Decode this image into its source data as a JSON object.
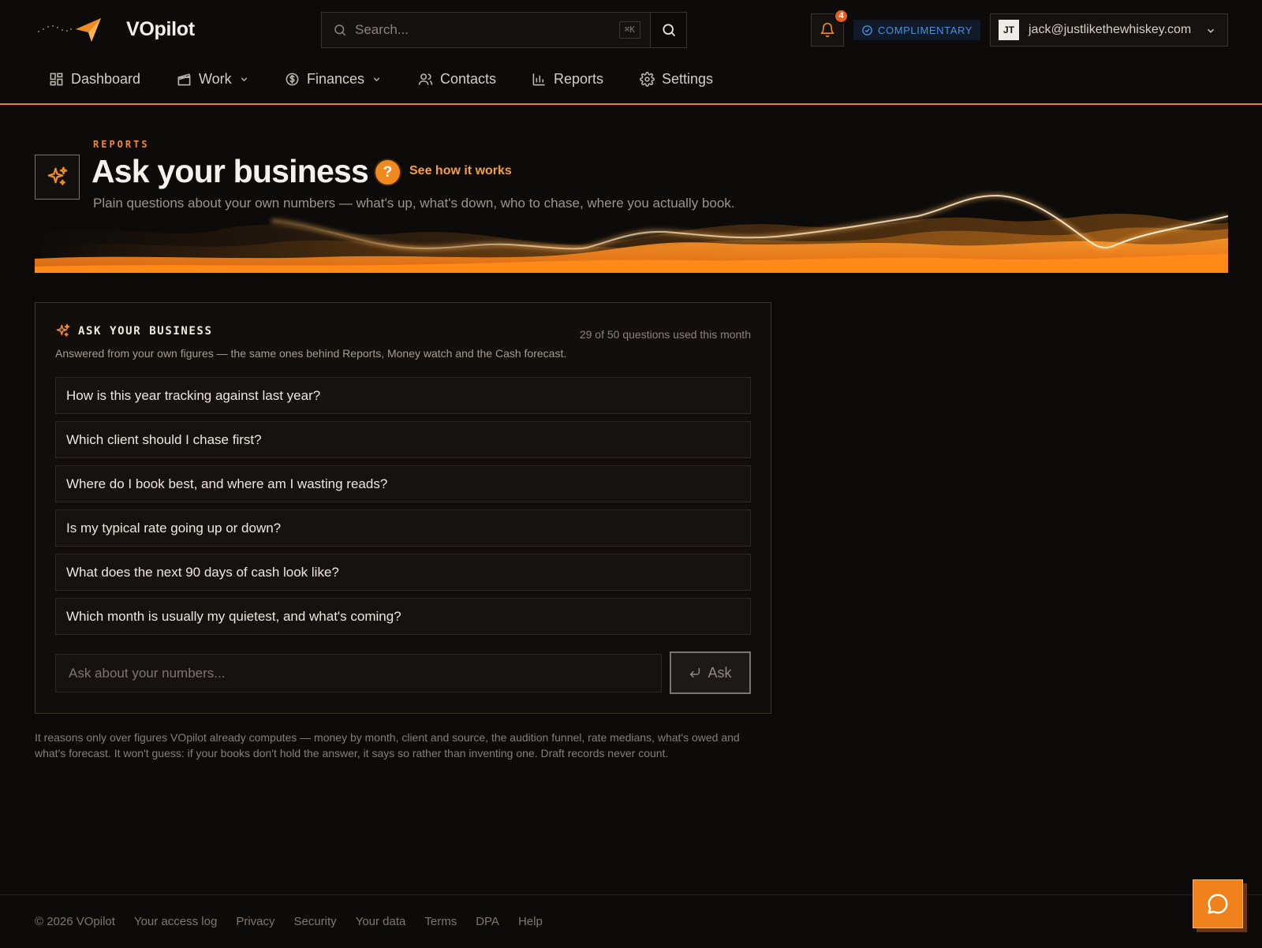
{
  "app": {
    "name": "VOpilot"
  },
  "search": {
    "placeholder": "Search...",
    "shortcut": "⌘K"
  },
  "notifications": {
    "count": "4"
  },
  "plan": {
    "label": "COMPLIMENTARY"
  },
  "user": {
    "initials": "JT",
    "email": "jack@justlikethewhiskey.com"
  },
  "nav": {
    "items": [
      {
        "label": "Dashboard",
        "icon": "dashboard-icon"
      },
      {
        "label": "Work",
        "icon": "clapperboard-icon",
        "has_dropdown": true
      },
      {
        "label": "Finances",
        "icon": "dollar-circle-icon",
        "has_dropdown": true
      },
      {
        "label": "Contacts",
        "icon": "users-icon"
      },
      {
        "label": "Reports",
        "icon": "bar-chart-icon"
      },
      {
        "label": "Settings",
        "icon": "gear-icon"
      }
    ]
  },
  "hero": {
    "eyebrow": "REPORTS",
    "title": "Ask your business",
    "help_label": "See how it works",
    "subtitle": "Plain questions about your own numbers — what's up, what's down, who to chase, where you actually book."
  },
  "card": {
    "title": "ASK YOUR BUSINESS",
    "quota": "29 of 50 questions used this month",
    "description": "Answered from your own figures — the same ones behind Reports, Money watch and the Cash forecast.",
    "questions": [
      "How is this year tracking against last year?",
      "Which client should I chase first?",
      "Where do I book best, and where am I wasting reads?",
      "Is my typical rate going up or down?",
      "What does the next 90 days of cash look like?",
      "Which month is usually my quietest, and what's coming?"
    ],
    "input_placeholder": "Ask about your numbers...",
    "ask_label": "Ask"
  },
  "note": "It reasons only over figures VOpilot already computes — money by month, client and source, the audition funnel, rate medians, what's owed and what's forecast. It won't guess: if your books don't hold the answer, it says so rather than inventing one. Draft records never count.",
  "footer": {
    "copyright": "© 2026 VOpilot",
    "links": [
      "Your access log",
      "Privacy",
      "Security",
      "Your data",
      "Terms",
      "DPA",
      "Help"
    ]
  },
  "colors": {
    "accent": "#f08a1e",
    "background": "#0d0b0a",
    "plan_badge": "#4a8fe0"
  }
}
